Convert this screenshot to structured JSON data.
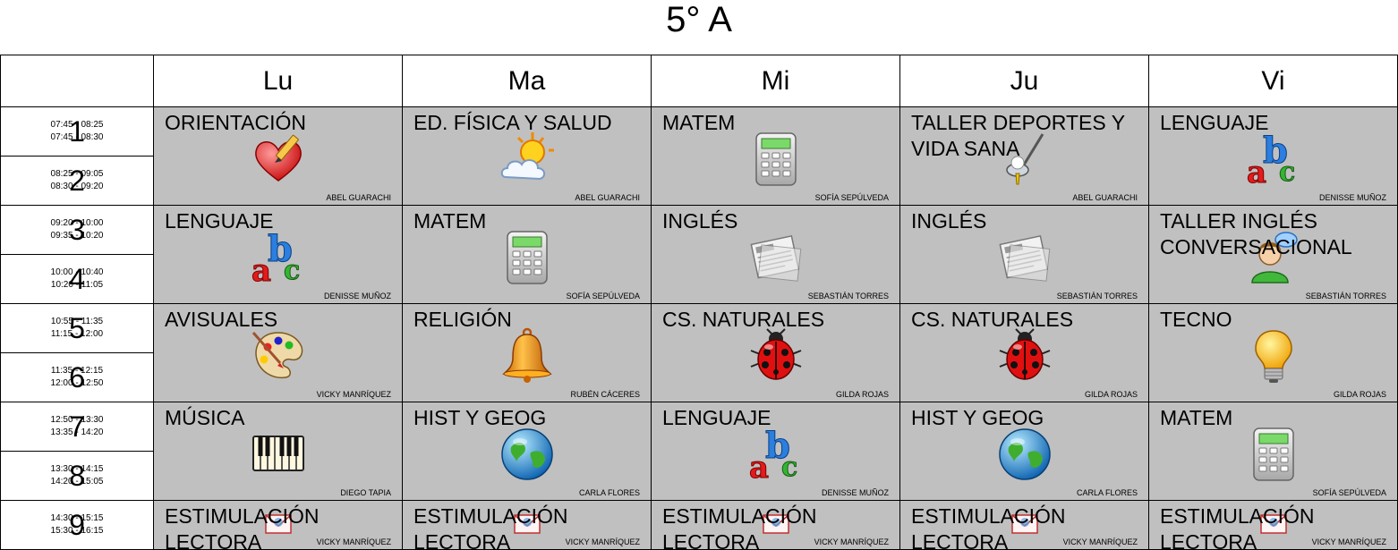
{
  "title": "5° A",
  "days": [
    "Lu",
    "Ma",
    "Mi",
    "Ju",
    "Vi"
  ],
  "periods": [
    {
      "num": "1",
      "times": [
        "07:45 - 08:25",
        "07:45 - 08:30"
      ]
    },
    {
      "num": "2",
      "times": [
        "08:25 - 09:05",
        "08:30 - 09:20"
      ]
    },
    {
      "num": "3",
      "times": [
        "09:20 - 10:00",
        "09:35 - 10:20"
      ]
    },
    {
      "num": "4",
      "times": [
        "10:00 - 10:40",
        "10:20 - 11:05"
      ]
    },
    {
      "num": "5",
      "times": [
        "10:55 - 11:35",
        "11:15 - 12:00"
      ]
    },
    {
      "num": "6",
      "times": [
        "11:35 - 12:15",
        "12:00 - 12:50"
      ]
    },
    {
      "num": "7",
      "times": [
        "12:50 - 13:30",
        "13:35 - 14:20"
      ]
    },
    {
      "num": "8",
      "times": [
        "13:30 - 14:15",
        "14:20 - 15:05"
      ]
    },
    {
      "num": "9",
      "times": [
        "14:30 - 15:15",
        "15:30 - 16:15"
      ]
    }
  ],
  "blocks": [
    {
      "cells": [
        {
          "subject": "ORIENTACIÓN",
          "teacher": "ABEL GUARACHI",
          "icon": "heart-pencil-icon"
        },
        {
          "subject": "ED. FÍSICA Y SALUD",
          "teacher": "ABEL GUARACHI",
          "icon": "sun-cloud-icon"
        },
        {
          "subject": "MATEM",
          "teacher": "SOFÍA SEPÚLVEDA",
          "icon": "calculator-icon"
        },
        {
          "subject": "TALLER DEPORTES Y VIDA SANA",
          "teacher": "ABEL GUARACHI",
          "icon": "golf-club-icon"
        },
        {
          "subject": "LENGUAJE",
          "teacher": "DENISSE MUÑOZ",
          "icon": "abc-icon"
        }
      ]
    },
    {
      "cells": [
        {
          "subject": "LENGUAJE",
          "teacher": "DENISSE MUÑOZ",
          "icon": "abc-icon"
        },
        {
          "subject": "MATEM",
          "teacher": "SOFÍA SEPÚLVEDA",
          "icon": "calculator-icon"
        },
        {
          "subject": "INGLÉS",
          "teacher": "SEBASTIÁN TORRES",
          "icon": "newspaper-icon"
        },
        {
          "subject": "INGLÉS",
          "teacher": "SEBASTIÁN TORRES",
          "icon": "newspaper-icon"
        },
        {
          "subject": "TALLER INGLÉS CONVERSACIONAL",
          "teacher": "SEBASTIÁN TORRES",
          "icon": "user-chat-icon"
        }
      ]
    },
    {
      "cells": [
        {
          "subject": "AVISUALES",
          "teacher": "VICKY MANRÍQUEZ",
          "icon": "paint-palette-icon"
        },
        {
          "subject": "RELIGIÓN",
          "teacher": "RUBÉN CÁCERES",
          "icon": "bell-icon"
        },
        {
          "subject": "CS. NATURALES",
          "teacher": "GILDA ROJAS",
          "icon": "ladybug-icon"
        },
        {
          "subject": "CS. NATURALES",
          "teacher": "GILDA ROJAS",
          "icon": "ladybug-icon"
        },
        {
          "subject": "TECNO",
          "teacher": "GILDA ROJAS",
          "icon": "light-bulb-icon"
        }
      ]
    },
    {
      "cells": [
        {
          "subject": "MÚSICA",
          "teacher": "DIEGO TAPIA",
          "icon": "piano-keys-icon"
        },
        {
          "subject": "HIST Y GEOG",
          "teacher": "CARLA FLORES",
          "icon": "globe-icon"
        },
        {
          "subject": "LENGUAJE",
          "teacher": "DENISSE MUÑOZ",
          "icon": "abc-icon"
        },
        {
          "subject": "HIST Y GEOG",
          "teacher": "CARLA FLORES",
          "icon": "globe-icon"
        },
        {
          "subject": "MATEM",
          "teacher": "SOFÍA SEPÚLVEDA",
          "icon": "calculator-icon"
        }
      ]
    },
    {
      "cells": [
        {
          "subject": "ESTIMULACIÓN LECTORA",
          "teacher": "VICKY MANRÍQUEZ",
          "icon": "mail-icon"
        },
        {
          "subject": "ESTIMULACIÓN LECTORA",
          "teacher": "VICKY MANRÍQUEZ",
          "icon": "mail-icon"
        },
        {
          "subject": "ESTIMULACIÓN LECTORA",
          "teacher": "VICKY MANRÍQUEZ",
          "icon": "mail-icon"
        },
        {
          "subject": "ESTIMULACIÓN LECTORA",
          "teacher": "VICKY MANRÍQUEZ",
          "icon": "mail-icon"
        },
        {
          "subject": "ESTIMULACIÓN LECTORA",
          "teacher": "VICKY MANRÍQUEZ",
          "icon": "mail-icon"
        }
      ]
    }
  ]
}
